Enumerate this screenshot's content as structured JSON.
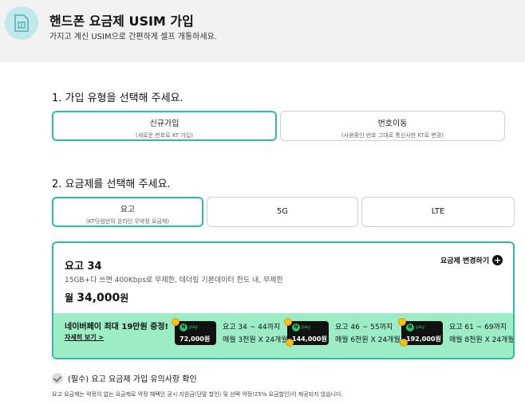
{
  "header": {
    "title": "핸드폰 요금제 USIM 가입",
    "subtitle": "가지고 계신 USIM으로 간편하게 셀프 개통하세요.",
    "icon": "sim-card-icon",
    "icon_bg": "#bfe9ea"
  },
  "step1": {
    "title": "1. 가입 유형을 선택해 주세요.",
    "options": [
      {
        "label": "신규가입",
        "sub": "(새로운 번호로 KT 가입)",
        "selected": true
      },
      {
        "label": "번호이동",
        "sub": "(사용중인 번호 그대로 통신사만 KT로 변경)",
        "selected": false
      }
    ]
  },
  "step2": {
    "title": "2. 요금제를 선택해 주세요.",
    "tabs": [
      {
        "label": "요고",
        "sub": "(KT닷컴만의 온라인 무약정 요금제)",
        "selected": true
      },
      {
        "label": "5G",
        "selected": false
      },
      {
        "label": "LTE",
        "selected": false
      }
    ]
  },
  "plan": {
    "name": "요고 34",
    "desc": "15GB+다 쓰면 400Kbps로 무제한, 테더링 기본데이터 한도 내, 무제한",
    "price_prefix": "월",
    "price": "34,000",
    "price_unit": "원",
    "change_label": "요금제 변경하기"
  },
  "promo": {
    "title": "네이버페이 최대 19만원 증정!",
    "link": "자세히 보기 >",
    "bg": "#9cedc6",
    "pay_label": "pay",
    "pay_logo": "N",
    "tiers": [
      {
        "amount": "72,000",
        "unit": "원",
        "range": "요고 34 ~ 44까지",
        "monthly": "매월 3천원 X 24개월"
      },
      {
        "amount": "144,000",
        "unit": "원",
        "range": "요고 46 ~ 55까지",
        "monthly": "매월 6천원 X 24개월"
      },
      {
        "amount": "192,000",
        "unit": "원",
        "range": "요고 61 ~ 69까지",
        "monthly": "매월 8천원 X 24개월"
      }
    ]
  },
  "agreement": {
    "label": "(필수) 요고 요금제 가입 유의사항 확인",
    "notice": "요고 요금제는 약정이 없는 요금제로 약정 혜택인 공시 지원금(단말 할인) 및 선택 약정(25% 요금할인)이 제공되지 않습니다."
  },
  "colors": {
    "accent": "#2bbfa9"
  }
}
